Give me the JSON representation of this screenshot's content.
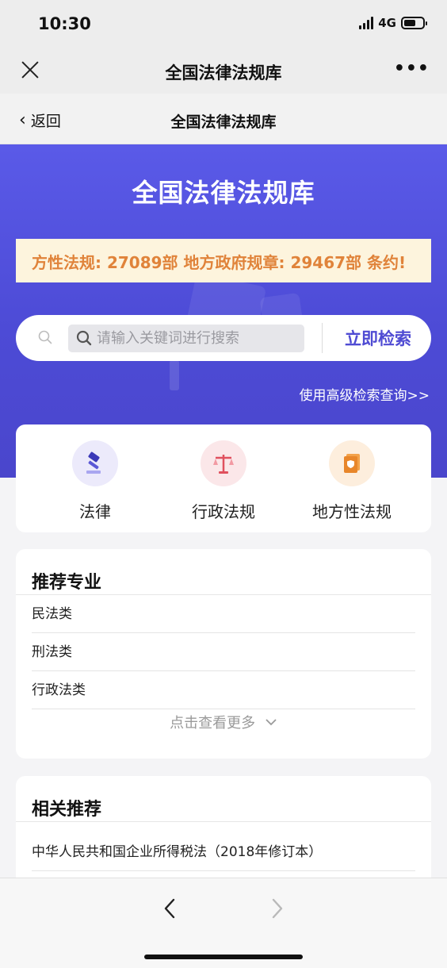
{
  "status": {
    "time": "10:30",
    "network": "4G"
  },
  "wechat": {
    "title": "全国法律法规库",
    "more": "•••"
  },
  "nav": {
    "back": "返回",
    "title": "全国法律法规库"
  },
  "hero": {
    "title": "全国法律法规库",
    "marquee": "方性法规: 27089部 地方政府规章: 29467部 条约!"
  },
  "search": {
    "placeholder": "请输入关键词进行搜索",
    "button": "立即检索",
    "advanced": "使用高级检索查询>>"
  },
  "categories": [
    {
      "label": "法律",
      "icon": "gavel-icon",
      "bg": "#eceafb"
    },
    {
      "label": "行政法规",
      "icon": "scale-icon",
      "bg": "#fbe7e9"
    },
    {
      "label": "地方性法规",
      "icon": "document-shield-icon",
      "bg": "#fdeedd"
    }
  ],
  "recommended": {
    "title": "推荐专业",
    "items": [
      "民法类",
      "刑法类",
      "行政法类"
    ],
    "more": "点击查看更多"
  },
  "related": {
    "title": "相关推荐",
    "items": [
      "中华人民共和国企业所得税法（2018年修订本）"
    ]
  },
  "colors": {
    "accent": "#4f4bd3",
    "hero": "#5656e0",
    "marquee_text": "#e0833a",
    "marquee_bg": "#fdf4dd"
  }
}
